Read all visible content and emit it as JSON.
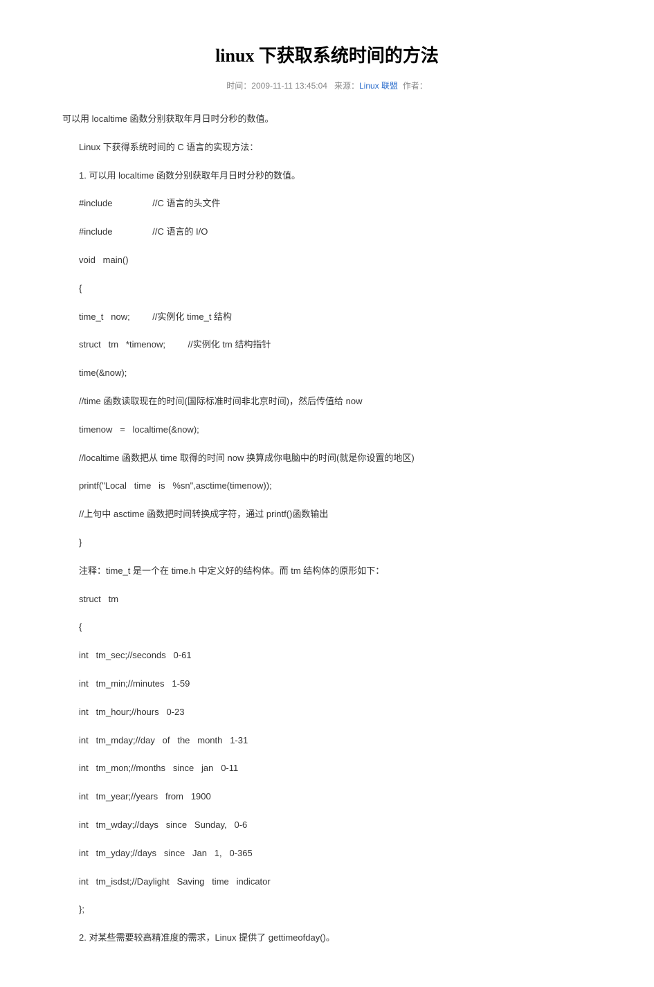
{
  "title": "linux 下获取系统时间的方法",
  "meta": {
    "time_label": "时间：",
    "time_value": "2009-11-11 13:45:04",
    "source_label": "来源：",
    "source_link": "Linux 联盟",
    "author_label": "作者："
  },
  "lines": [
    "可以用 localtime 函数分别获取年月日时分秒的数值。",
    "Linux 下获得系统时间的 C 语言的实现方法：",
    "1. 可以用 localtime 函数分别获取年月日时分秒的数值。",
    "#include                //C 语言的头文件",
    "#include                //C 语言的 I/O",
    "void   main()",
    "{",
    "time_t   now;         //实例化 time_t 结构",
    "struct   tm   *timenow;         //实例化 tm 结构指针",
    "time(&now);",
    "//time 函数读取现在的时间(国际标准时间非北京时间)，然后传值给 now",
    "timenow   =   localtime(&now);",
    "//localtime 函数把从 time 取得的时间 now 换算成你电脑中的时间(就是你设置的地区)",
    "printf(\"Local   time   is   %sn\",asctime(timenow));",
    "//上句中 asctime 函数把时间转换成字符，通过 printf()函数输出",
    "}",
    "注释：time_t 是一个在 time.h 中定义好的结构体。而 tm 结构体的原形如下：",
    "struct   tm",
    "{",
    "int   tm_sec;//seconds   0-61",
    "int   tm_min;//minutes   1-59",
    "int   tm_hour;//hours   0-23",
    "int   tm_mday;//day   of   the   month   1-31",
    "int   tm_mon;//months   since   jan   0-11",
    "int   tm_year;//years   from   1900",
    "int   tm_wday;//days   since   Sunday,   0-6",
    "int   tm_yday;//days   since   Jan   1,   0-365",
    "int   tm_isdst;//Daylight   Saving   time   indicator",
    "};",
    "2. 对某些需要较高精准度的需求，Linux 提供了 gettimeofday()。"
  ]
}
